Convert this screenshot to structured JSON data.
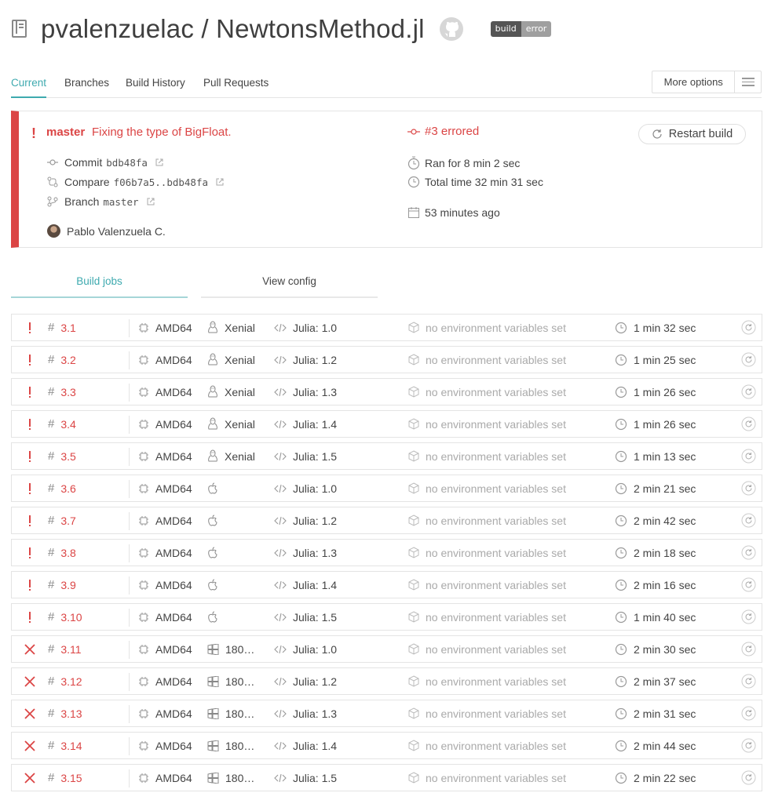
{
  "header": {
    "repo_title": "pvalenzuelac / NewtonsMethod.jl",
    "badge_left": "build",
    "badge_right": "error"
  },
  "tabs": [
    "Current",
    "Branches",
    "Build History",
    "Pull Requests"
  ],
  "more_options_label": "More options",
  "build": {
    "branch": "master",
    "message": "Fixing the type of BigFloat.",
    "commit_label": "Commit",
    "commit_hash": "bdb48fa",
    "compare_label": "Compare",
    "compare_range": "f06b7a5..bdb48fa",
    "branch_label": "Branch",
    "branch_name": "master",
    "author": "Pablo Valenzuela C.",
    "status": "#3 errored",
    "ran_for": "Ran for 8 min 2 sec",
    "total_time": "Total time 32 min 31 sec",
    "finished": "53 minutes ago",
    "restart_label": "Restart build",
    "status_color": "#db4545",
    "accent_color": "#3eaaaf"
  },
  "subtabs": [
    "Build jobs",
    "View config"
  ],
  "jobs": [
    {
      "state": "errored",
      "num": "3.1",
      "arch": "AMD64",
      "os": "linux",
      "os_label": "Xenial",
      "lang": "Julia: 1.0",
      "env": "no environment variables set",
      "duration": "1 min 32 sec"
    },
    {
      "state": "errored",
      "num": "3.2",
      "arch": "AMD64",
      "os": "linux",
      "os_label": "Xenial",
      "lang": "Julia: 1.2",
      "env": "no environment variables set",
      "duration": "1 min 25 sec"
    },
    {
      "state": "errored",
      "num": "3.3",
      "arch": "AMD64",
      "os": "linux",
      "os_label": "Xenial",
      "lang": "Julia: 1.3",
      "env": "no environment variables set",
      "duration": "1 min 26 sec"
    },
    {
      "state": "errored",
      "num": "3.4",
      "arch": "AMD64",
      "os": "linux",
      "os_label": "Xenial",
      "lang": "Julia: 1.4",
      "env": "no environment variables set",
      "duration": "1 min 26 sec"
    },
    {
      "state": "errored",
      "num": "3.5",
      "arch": "AMD64",
      "os": "linux",
      "os_label": "Xenial",
      "lang": "Julia: 1.5",
      "env": "no environment variables set",
      "duration": "1 min 13 sec"
    },
    {
      "state": "errored",
      "num": "3.6",
      "arch": "AMD64",
      "os": "osx",
      "os_label": "",
      "lang": "Julia: 1.0",
      "env": "no environment variables set",
      "duration": "2 min 21 sec"
    },
    {
      "state": "errored",
      "num": "3.7",
      "arch": "AMD64",
      "os": "osx",
      "os_label": "",
      "lang": "Julia: 1.2",
      "env": "no environment variables set",
      "duration": "2 min 42 sec"
    },
    {
      "state": "errored",
      "num": "3.8",
      "arch": "AMD64",
      "os": "osx",
      "os_label": "",
      "lang": "Julia: 1.3",
      "env": "no environment variables set",
      "duration": "2 min 18 sec"
    },
    {
      "state": "errored",
      "num": "3.9",
      "arch": "AMD64",
      "os": "osx",
      "os_label": "",
      "lang": "Julia: 1.4",
      "env": "no environment variables set",
      "duration": "2 min 16 sec"
    },
    {
      "state": "errored",
      "num": "3.10",
      "arch": "AMD64",
      "os": "osx",
      "os_label": "",
      "lang": "Julia: 1.5",
      "env": "no environment variables set",
      "duration": "1 min 40 sec"
    },
    {
      "state": "failed",
      "num": "3.11",
      "arch": "AMD64",
      "os": "windows",
      "os_label": "180…",
      "lang": "Julia: 1.0",
      "env": "no environment variables set",
      "duration": "2 min 30 sec"
    },
    {
      "state": "failed",
      "num": "3.12",
      "arch": "AMD64",
      "os": "windows",
      "os_label": "180…",
      "lang": "Julia: 1.2",
      "env": "no environment variables set",
      "duration": "2 min 37 sec"
    },
    {
      "state": "failed",
      "num": "3.13",
      "arch": "AMD64",
      "os": "windows",
      "os_label": "180…",
      "lang": "Julia: 1.3",
      "env": "no environment variables set",
      "duration": "2 min 31 sec"
    },
    {
      "state": "failed",
      "num": "3.14",
      "arch": "AMD64",
      "os": "windows",
      "os_label": "180…",
      "lang": "Julia: 1.4",
      "env": "no environment variables set",
      "duration": "2 min 44 sec"
    },
    {
      "state": "failed",
      "num": "3.15",
      "arch": "AMD64",
      "os": "windows",
      "os_label": "180…",
      "lang": "Julia: 1.5",
      "env": "no environment variables set",
      "duration": "2 min 22 sec"
    }
  ]
}
